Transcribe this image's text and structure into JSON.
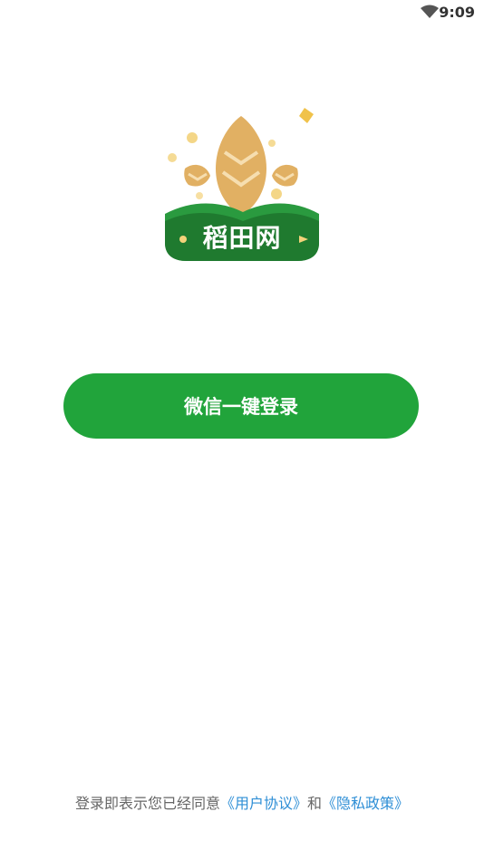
{
  "status_bar": {
    "time": "9:09",
    "icons": [
      "wifi-icon"
    ]
  },
  "logo": {
    "text": "稻田网",
    "colors": {
      "grain": "#e1b063",
      "field": "#2a9a3f",
      "field_dark": "#1f7a2f",
      "sparkle": "#f3d27a"
    }
  },
  "login": {
    "button_label": "微信一键登录",
    "button_color": "#21a43b"
  },
  "agreement": {
    "prefix": "登录即表示您已经同意",
    "user_agreement": "《用户协议》",
    "and": "和",
    "privacy_policy": "《隐私政策》",
    "link_color": "#2f8fd6"
  }
}
